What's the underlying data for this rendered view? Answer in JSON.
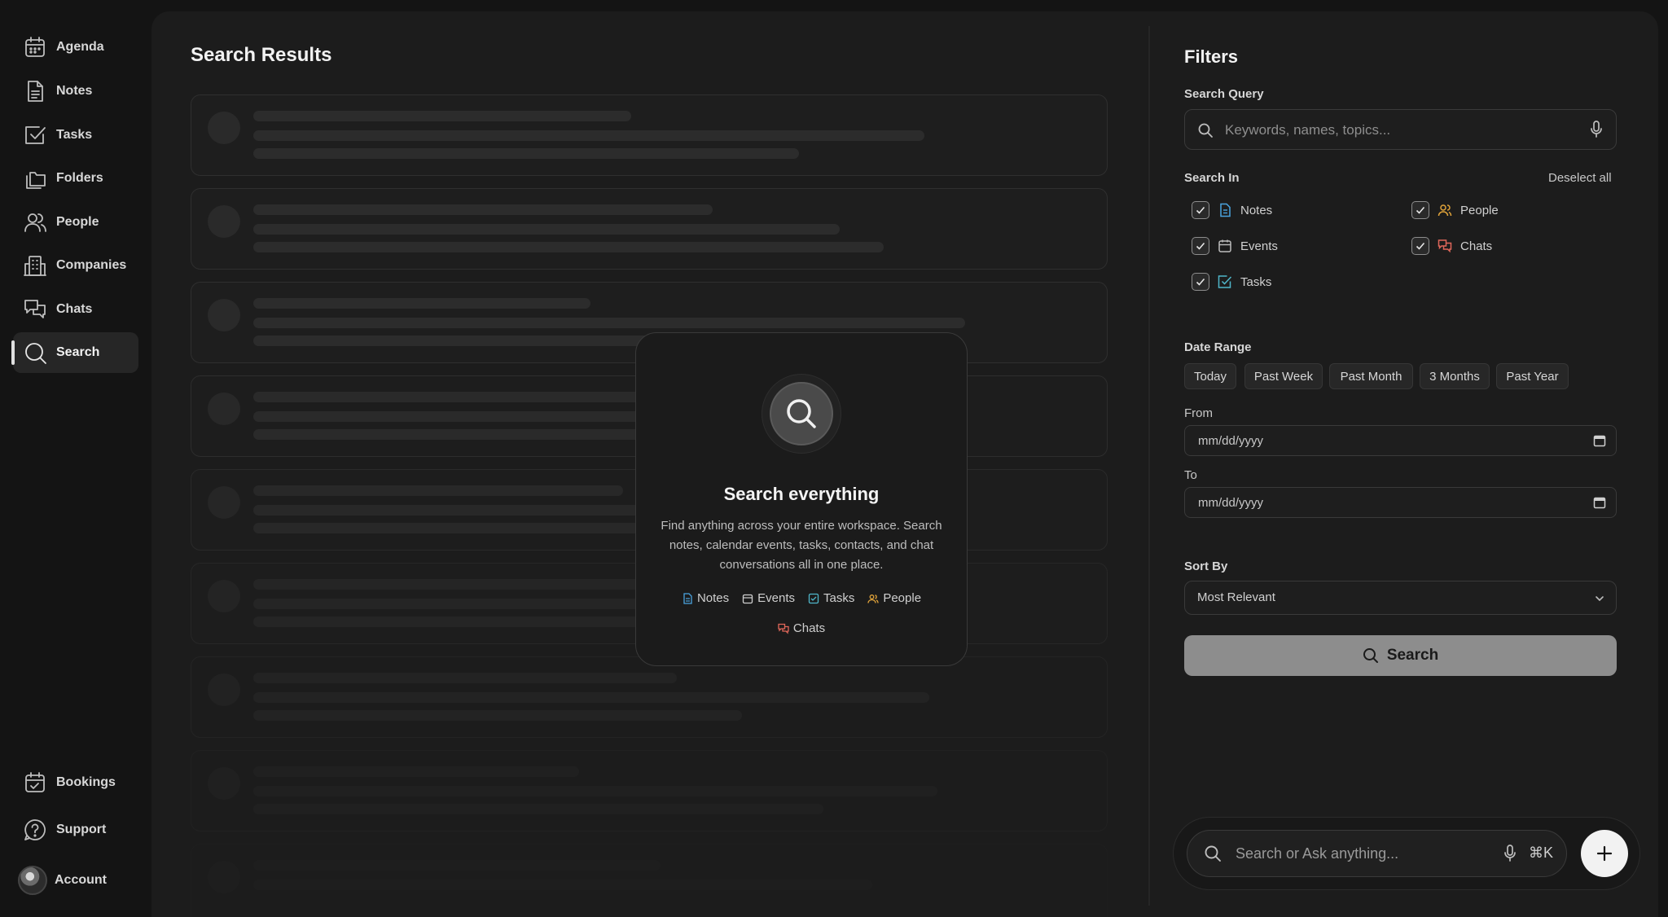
{
  "sidebar": {
    "items": [
      {
        "label": "Agenda",
        "icon": "calendar-icon"
      },
      {
        "label": "Notes",
        "icon": "note-icon"
      },
      {
        "label": "Tasks",
        "icon": "checkbox-icon"
      },
      {
        "label": "Folders",
        "icon": "folders-icon"
      },
      {
        "label": "People",
        "icon": "people-icon"
      },
      {
        "label": "Companies",
        "icon": "building-icon"
      },
      {
        "label": "Chats",
        "icon": "chat-icon"
      },
      {
        "label": "Search",
        "icon": "search-icon",
        "active": true
      }
    ],
    "bottom_items": [
      {
        "label": "Bookings",
        "icon": "calendar-check-icon"
      },
      {
        "label": "Support",
        "icon": "help-icon"
      },
      {
        "label": "Account",
        "icon": "avatar"
      }
    ]
  },
  "results": {
    "title": "Search Results"
  },
  "empty_state": {
    "title": "Search everything",
    "description": "Find anything across your entire workspace. Search notes, calendar events, tasks, contacts, and chat conversations all in one place.",
    "tags": [
      "Notes",
      "Events",
      "Tasks",
      "People",
      "Chats"
    ]
  },
  "filters": {
    "title": "Filters",
    "search_query_label": "Search Query",
    "search_query_placeholder": "Keywords, names, topics...",
    "search_in_label": "Search In",
    "deselect_all": "Deselect all",
    "search_in": [
      {
        "label": "Notes",
        "checked": true,
        "color": "#4aa3df"
      },
      {
        "label": "People",
        "checked": true,
        "color": "#e0a33a"
      },
      {
        "label": "Events",
        "checked": true,
        "color": "#bdbdbd"
      },
      {
        "label": "Chats",
        "checked": true,
        "color": "#e0675a"
      },
      {
        "label": "Tasks",
        "checked": true,
        "color": "#4fb6c9"
      }
    ],
    "date_range_label": "Date Range",
    "date_presets": [
      "Today",
      "Past Week",
      "Past Month",
      "3 Months",
      "Past Year"
    ],
    "from_label": "From",
    "from_value": "mm/dd/yyyy",
    "to_label": "To",
    "to_value": "mm/dd/yyyy",
    "sort_by_label": "Sort By",
    "sort_by_value": "Most Relevant",
    "search_button": "Search"
  },
  "bottom_bar": {
    "placeholder": "Search or Ask anything...",
    "shortcut": "⌘K"
  }
}
